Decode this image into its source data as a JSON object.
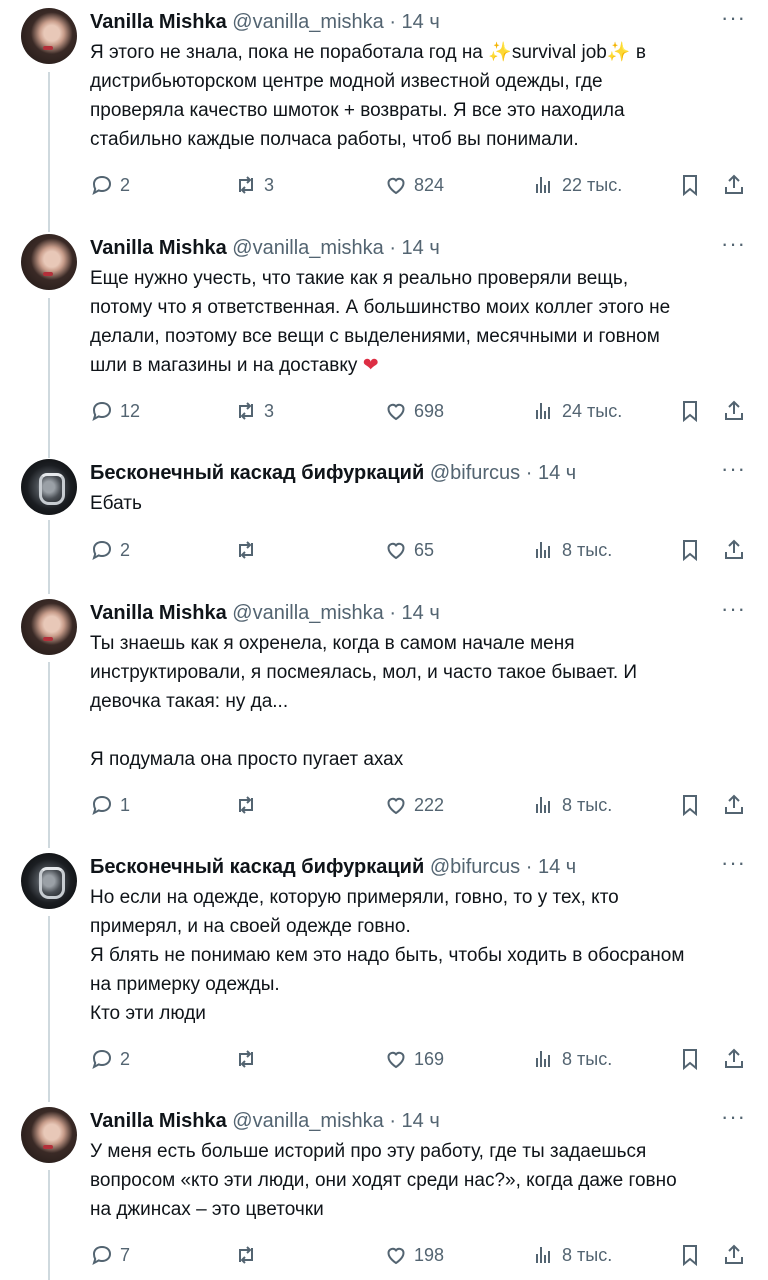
{
  "tweets": [
    {
      "name": "Vanilla Mishka",
      "handle": "@vanilla_mishka",
      "time": "· 14 ч",
      "avatar": "girl",
      "text_a": "Я этого не знала, пока не поработала год на ",
      "spark": "✨",
      "text_b": "survival job",
      "text_c": " в\nдистрибьюторском центре модной известной одежды, где\nпроверяла качество шмоток + возвраты. Я все это находила\nстабильно каждые полчаса работы, чтоб вы понимали.",
      "replies": "2",
      "retweets": "3",
      "likes": "824",
      "views": "22 тыс."
    },
    {
      "name": "Vanilla Mishka",
      "handle": "@vanilla_mishka",
      "time": "· 14 ч",
      "avatar": "girl",
      "text": "Еще нужно учесть, что такие как я реально проверяли вещь,\nпотому что я ответственная. А большинство моих коллег этого не\nделали, поэтому все вещи с выделениями, месячными и говном\nшли в магазины и на доставку ",
      "emoji": "❤",
      "replies": "12",
      "retweets": "3",
      "likes": "698",
      "views": "24 тыс."
    },
    {
      "name": "Бесконечный каскад бифуркаций",
      "handle": "@bifurcus",
      "time": "· 14 ч",
      "avatar": "robot",
      "text": "Ебать",
      "replies": "2",
      "retweets": "",
      "likes": "65",
      "views": "8 тыс."
    },
    {
      "name": "Vanilla Mishka",
      "handle": "@vanilla_mishka",
      "time": "· 14 ч",
      "avatar": "girl",
      "text": "Ты знаешь как я охренела, когда в самом начале меня\nинструктировали, я посмеялась, мол, и часто такое бывает. И\nдевочка такая: ну да...\n\nЯ подумала она просто пугает ахах",
      "replies": "1",
      "retweets": "",
      "likes": "222",
      "views": "8 тыс."
    },
    {
      "name": "Бесконечный каскад бифуркаций",
      "handle": "@bifurcus",
      "time": "· 14 ч",
      "avatar": "robot",
      "text": "Но если на одежде, которую примеряли, говно, то у тех, кто\nпримерял, и на своей одежде говно.\nЯ блять не понимаю кем это надо быть, чтобы ходить в обосраном\nна примерку одежды.\nКто эти люди",
      "replies": "2",
      "retweets": "",
      "likes": "169",
      "views": "8 тыс."
    },
    {
      "name": "Vanilla Mishka",
      "handle": "@vanilla_mishka",
      "time": "· 14 ч",
      "avatar": "girl",
      "text": "У меня есть больше историй про эту работу, где ты задаешься\nвопросом «кто эти люди, они ходят среди нас?», когда даже говно\nна джинсах – это цветочки",
      "replies": "7",
      "retweets": "",
      "likes": "198",
      "views": "8 тыс."
    }
  ],
  "more_label": "···",
  "icons": [
    "reply-icon",
    "retweet-icon",
    "like-icon",
    "views-icon",
    "bookmark-icon",
    "share-icon"
  ],
  "colors": {
    "text": "#0f1419",
    "secondary": "#536471",
    "thread": "#cfd9de",
    "heart": "#dd2e44",
    "sparkle": "#f5b400"
  }
}
